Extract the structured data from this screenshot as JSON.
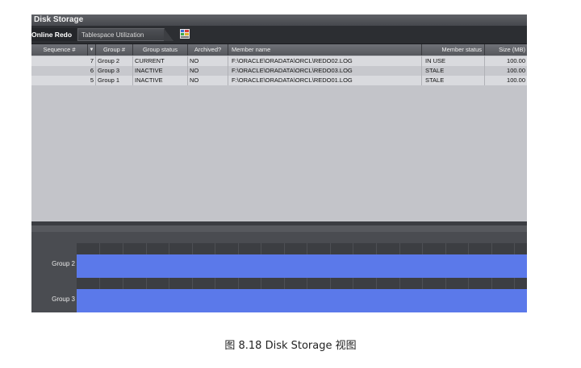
{
  "window": {
    "title": "Disk Storage"
  },
  "tabs": [
    {
      "label": "Online Redo"
    },
    {
      "label": "Tablespace Utilization"
    }
  ],
  "toolbar": {
    "icon": "grid-chart-icon"
  },
  "table": {
    "columns": [
      "Sequence #",
      "Group #",
      "Group status",
      "Archived?",
      "Member name",
      "Member status",
      "Size (MB)"
    ],
    "sort_indicator": "▼",
    "rows": [
      [
        "7",
        "Group 2",
        "CURRENT",
        "NO",
        "F:\\ORACLE\\ORADATA\\ORCL\\REDO02.LOG",
        "IN USE",
        "100.00"
      ],
      [
        "6",
        "Group 3",
        "INACTIVE",
        "NO",
        "F:\\ORACLE\\ORADATA\\ORCL\\REDO03.LOG",
        "STALE",
        "100.00"
      ],
      [
        "5",
        "Group 1",
        "INACTIVE",
        "NO",
        "F:\\ORACLE\\ORADATA\\ORCL\\REDO01.LOG",
        "STALE",
        "100.00"
      ]
    ]
  },
  "scrollbar": {
    "left_arrow": "◄"
  },
  "timeline": {
    "rows": [
      {
        "label": "Group 2"
      },
      {
        "label": "Group 3"
      }
    ],
    "bar_color": "#5b79ea"
  },
  "caption": "图 8.18    Disk Storage 视图"
}
